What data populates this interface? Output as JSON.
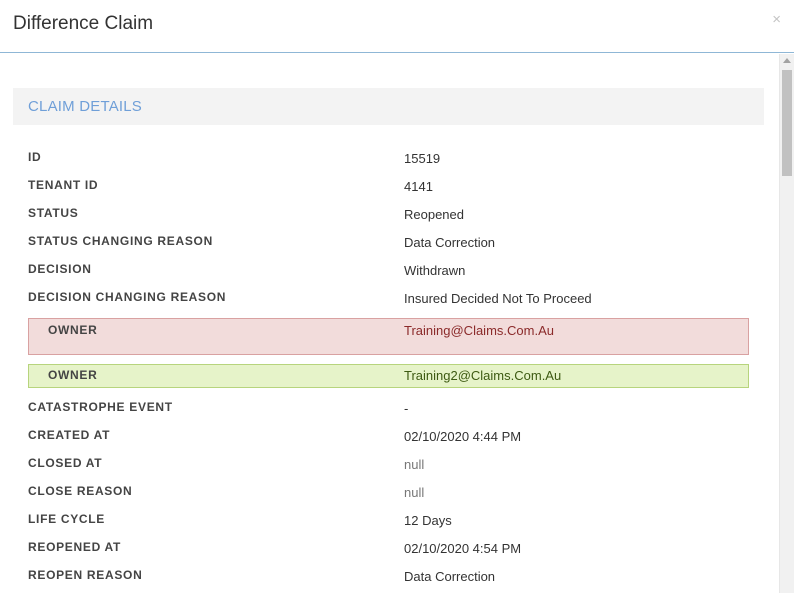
{
  "modal": {
    "title": "Difference Claim",
    "close_glyph": "×"
  },
  "section": {
    "title": "CLAIM DETAILS"
  },
  "details": {
    "id": {
      "label": "ID",
      "value": "15519"
    },
    "tenant_id": {
      "label": "TENANT ID",
      "value": "4141"
    },
    "status": {
      "label": "STATUS",
      "value": "Reopened"
    },
    "status_changing_reason": {
      "label": "STATUS CHANGING REASON",
      "value": "Data Correction"
    },
    "decision": {
      "label": "DECISION",
      "value": "Withdrawn"
    },
    "decision_changing_reason": {
      "label": "DECISION CHANGING REASON",
      "value": "Insured Decided Not To Proceed"
    },
    "owner_old": {
      "label": "OWNER",
      "value": "Training@Claims.Com.Au"
    },
    "owner_new": {
      "label": "OWNER",
      "value": "Training2@Claims.Com.Au"
    },
    "catastrophe_event": {
      "label": "CATASTROPHE EVENT",
      "value": "-"
    },
    "created_at": {
      "label": "CREATED AT",
      "value": "02/10/2020 4:44 PM"
    },
    "closed_at": {
      "label": "CLOSED AT",
      "value": "null"
    },
    "close_reason": {
      "label": "CLOSE REASON",
      "value": "null"
    },
    "life_cycle": {
      "label": "LIFE CYCLE",
      "value": "12 Days"
    },
    "reopened_at": {
      "label": "REOPENED AT",
      "value": "02/10/2020 4:54 PM"
    },
    "reopen_reason": {
      "label": "REOPEN REASON",
      "value": "Data Correction"
    }
  },
  "colors": {
    "section_title": "#6f9fd8",
    "removed_bg": "#f2dcdb",
    "added_bg": "#e6f3c9",
    "header_border": "#8fb7d6"
  }
}
